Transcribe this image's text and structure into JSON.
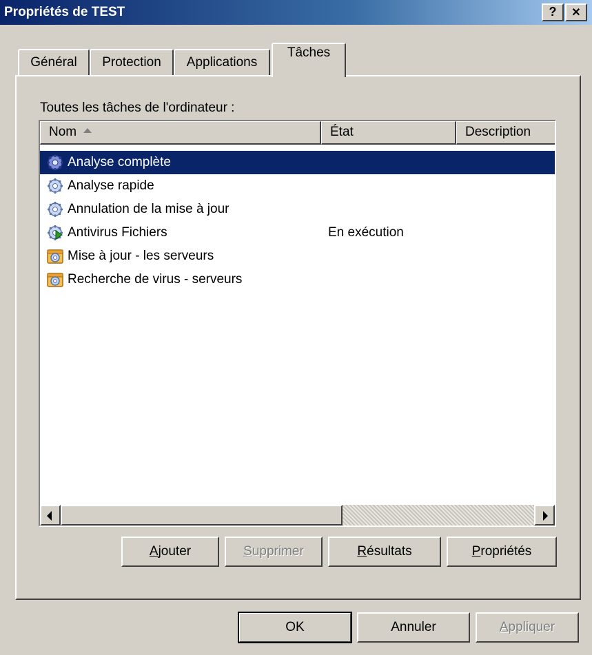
{
  "window": {
    "title": "Propriétés de TEST",
    "help_label": "?",
    "close_label": "✕"
  },
  "tabs": [
    {
      "label": "Général",
      "active": false
    },
    {
      "label": "Protection",
      "active": false
    },
    {
      "label": "Applications",
      "active": false
    },
    {
      "label": "Tâches",
      "active": true
    }
  ],
  "panel": {
    "list_caption": "Toutes les tâches de l'ordinateur :",
    "columns": [
      {
        "label": "Nom",
        "sorted": "ascending"
      },
      {
        "label": "État"
      },
      {
        "label": "Description"
      }
    ],
    "tasks": [
      {
        "name": "Analyse complète",
        "state": "",
        "description": "",
        "icon": "gear-icon-blue",
        "selected": true
      },
      {
        "name": "Analyse rapide",
        "state": "",
        "description": "",
        "icon": "gear-icon",
        "selected": false
      },
      {
        "name": "Annulation de la mise à jour",
        "state": "",
        "description": "",
        "icon": "gear-icon",
        "selected": false
      },
      {
        "name": "Antivirus Fichiers",
        "state": "En exécution",
        "description": "",
        "icon": "gear-running-icon",
        "selected": false
      },
      {
        "name": "Mise à jour - les serveurs",
        "state": "",
        "description": "",
        "icon": "group-task-icon",
        "selected": false
      },
      {
        "name": "Recherche de virus - serveurs",
        "state": "",
        "description": "",
        "icon": "group-task-icon",
        "selected": false
      }
    ],
    "buttons": {
      "add": {
        "label_underlined": "A",
        "label_rest": "jouter",
        "enabled": true
      },
      "delete": {
        "label_underlined": "S",
        "label_rest": "upprimer",
        "enabled": false
      },
      "results": {
        "label_underlined": "R",
        "label_rest": "ésultats",
        "enabled": true
      },
      "properties": {
        "label_underlined": "P",
        "label_rest": "ropriétés",
        "enabled": true
      }
    }
  },
  "footer": {
    "ok_label": "OK",
    "cancel_label": "Annuler",
    "apply_underlined": "A",
    "apply_rest": "ppliquer",
    "apply_enabled": false
  },
  "colors": {
    "selection": "#0a246a",
    "title_gradient_start": "#0a246a",
    "face": "#d4d0c8"
  }
}
